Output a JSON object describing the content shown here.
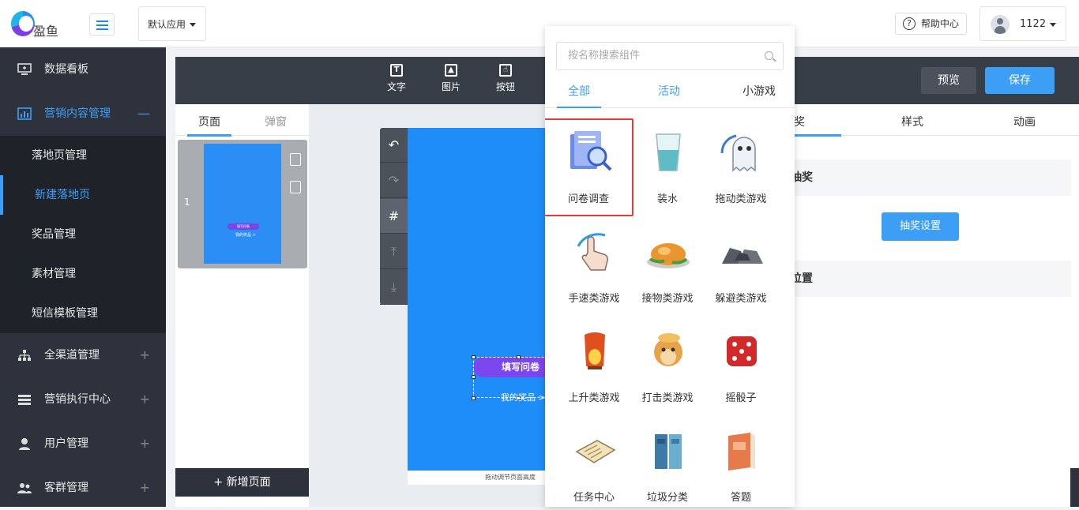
{
  "header": {
    "logo_text": "盈鱼",
    "app_selector": "默认应用",
    "help_label": "帮助中心",
    "user_name": "1122"
  },
  "sidebar": {
    "groups": [
      {
        "label": "数据看板",
        "icon": "monitor-icon",
        "toggle": ""
      },
      {
        "label": "营销内容管理",
        "icon": "bar-chart-icon",
        "toggle": "—"
      },
      {
        "label": "全渠道管理",
        "icon": "org-tree-icon",
        "toggle": "+"
      },
      {
        "label": "营销执行中心",
        "icon": "list-icon",
        "toggle": "+"
      },
      {
        "label": "用户管理",
        "icon": "user-icon",
        "toggle": "+"
      },
      {
        "label": "客群管理",
        "icon": "group-icon",
        "toggle": "+"
      }
    ],
    "sub_items": [
      "落地页管理",
      "新建落地页",
      "奖品管理",
      "素材管理",
      "短信模板管理"
    ]
  },
  "toolbar": {
    "tools": [
      {
        "label": "文字",
        "icon": "text-icon"
      },
      {
        "label": "图片",
        "icon": "image-icon"
      },
      {
        "label": "按钮",
        "icon": "pointer-icon"
      }
    ],
    "preview": "预览",
    "save": "保存"
  },
  "pages_panel": {
    "tabs": [
      "页面",
      "弹窗"
    ],
    "page_number": "1",
    "thumb_pill": "填写问卷",
    "thumb_link": "我的奖品 >",
    "add_page": "+ 新增页面"
  },
  "canvas": {
    "button_text": "填写问卷",
    "prize_link": "我的奖品 >",
    "drag_hint": "拖动调节页面高度"
  },
  "right_panel": {
    "tabs": [
      "抽奖",
      "样式",
      "动画"
    ],
    "section_lottery": "抽奖",
    "lottery_button": "抽奖设置",
    "section_position": "位置"
  },
  "component_popup": {
    "search_placeholder": "按名称搜索组件",
    "tabs": [
      "全部",
      "活动",
      "小游戏"
    ],
    "components": [
      {
        "label": "问卷调查",
        "icon": "survey-icon"
      },
      {
        "label": "装水",
        "icon": "water-glass-icon"
      },
      {
        "label": "拖动类游戏",
        "icon": "ghost-icon"
      },
      {
        "label": "手速类游戏",
        "icon": "tap-hand-icon"
      },
      {
        "label": "接物类游戏",
        "icon": "roast-chicken-icon"
      },
      {
        "label": "躲避类游戏",
        "icon": "rocks-icon"
      },
      {
        "label": "上升类游戏",
        "icon": "lantern-icon"
      },
      {
        "label": "打击类游戏",
        "icon": "hamster-icon"
      },
      {
        "label": "摇骰子",
        "icon": "dice-icon"
      },
      {
        "label": "任务中心",
        "icon": "clipboard-icon"
      },
      {
        "label": "垃圾分类",
        "icon": "trash-bins-icon"
      },
      {
        "label": "答题",
        "icon": "book-icon"
      }
    ]
  },
  "colors": {
    "accent": "#3d9ef5",
    "sidebar_bg": "#2d323c",
    "canvas_bg": "#1f8df7",
    "pill": "#7c46ee",
    "highlight": "#e63b3b"
  }
}
